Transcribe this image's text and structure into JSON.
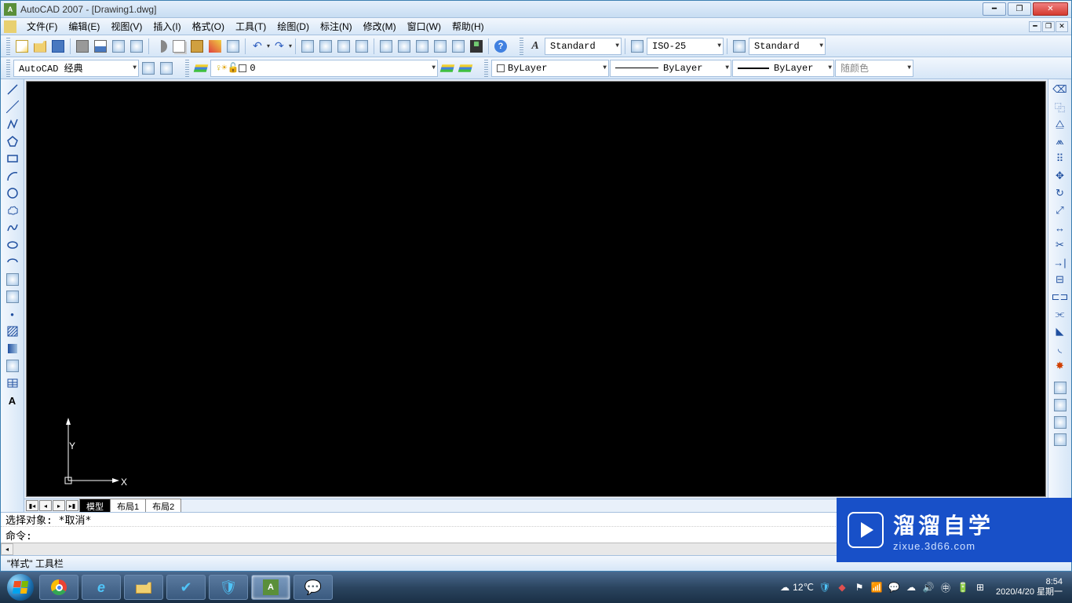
{
  "title": "AutoCAD 2007 - [Drawing1.dwg]",
  "menu": {
    "file": "文件(F)",
    "edit": "编辑(E)",
    "view": "视图(V)",
    "insert": "插入(I)",
    "format": "格式(O)",
    "tools": "工具(T)",
    "draw": "绘图(D)",
    "dimension": "标注(N)",
    "modify": "修改(M)",
    "window": "窗口(W)",
    "help": "帮助(H)"
  },
  "workspace": "AutoCAD 经典",
  "layer_current": "0",
  "styles": {
    "text_style": "Standard",
    "dim_style": "ISO-25",
    "table_style": "Standard"
  },
  "props": {
    "color": "ByLayer",
    "linetype": "ByLayer",
    "lineweight": "ByLayer",
    "plot_style": "随颜色"
  },
  "model_tabs": {
    "model": "模型",
    "layout1": "布局1",
    "layout2": "布局2"
  },
  "command": {
    "history": "选择对象: *取消*",
    "prompt": "命令:"
  },
  "status_tip": "\"样式\" 工具栏",
  "ucs": {
    "x": "X",
    "y": "Y"
  },
  "watermark": {
    "big": "溜溜自学",
    "small": "zixue.3d66.com"
  },
  "taskbar": {
    "weather_temp": "12℃",
    "time": "8:54",
    "date": "2020/4/20",
    "weekday": "星期一"
  }
}
